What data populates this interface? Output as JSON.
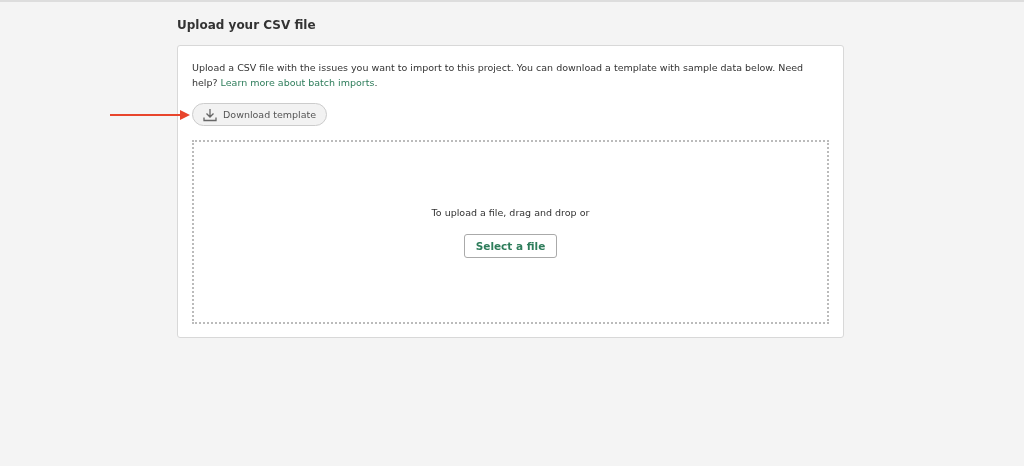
{
  "title": "Upload your CSV file",
  "description": {
    "text": "Upload a CSV file with the issues you want to import to this project. You can download a template with sample data below. Need help?",
    "link": "Learn more about batch imports",
    "after": "."
  },
  "download_button": {
    "label": "Download template"
  },
  "dropzone": {
    "prompt": "To upload a file, drag and drop or",
    "button": "Select a file"
  }
}
